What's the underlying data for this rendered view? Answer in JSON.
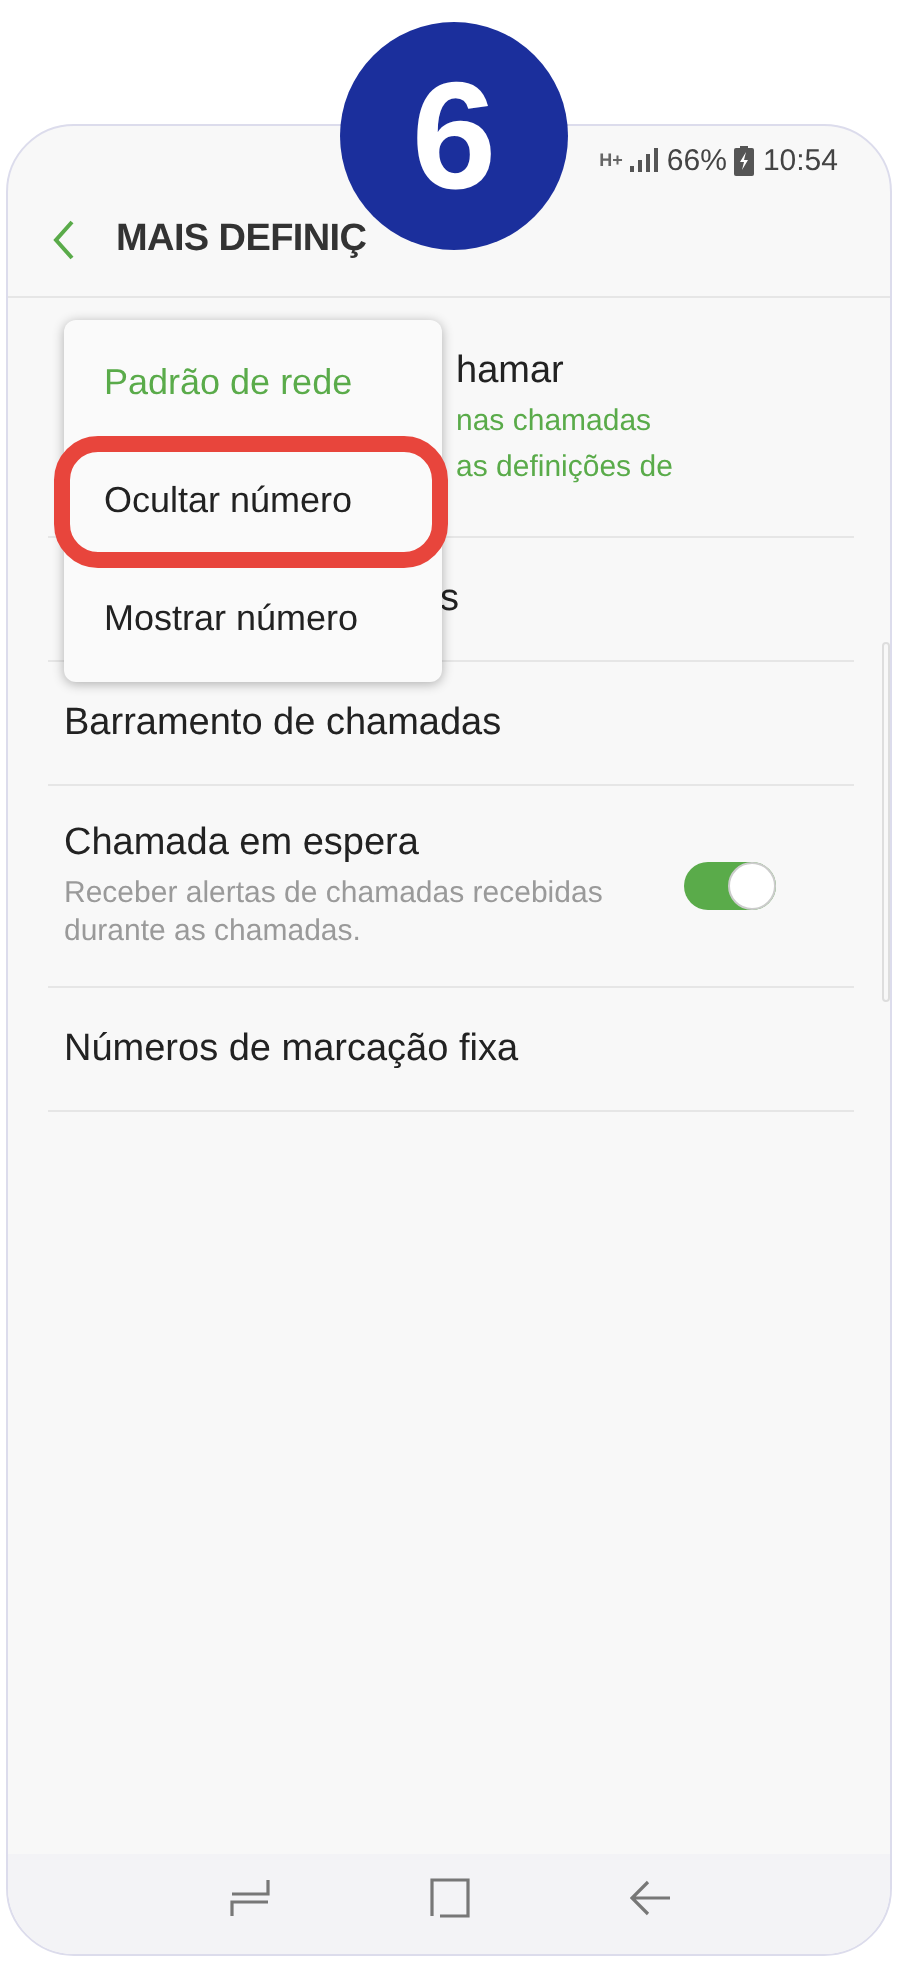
{
  "step_badge": {
    "number": "6"
  },
  "status_bar": {
    "network": "H+",
    "battery": "66%",
    "time": "10:54"
  },
  "header": {
    "title": "MAIS DEFINIÇ"
  },
  "rows": [
    {
      "kind": "covered",
      "title": "hamar",
      "subtitle_lines": [
        "nas chamadas",
        "as definições de"
      ],
      "accent": true
    },
    {
      "kind": "covered",
      "title": "s"
    },
    {
      "kind": "plain",
      "title": "Barramento de chamadas"
    },
    {
      "kind": "toggle",
      "title": "Chamada em espera",
      "subtitle": "Receber alertas de chamadas recebidas durante as chamadas.",
      "on": true
    },
    {
      "kind": "plain",
      "title": "Números de marcação fixa"
    }
  ],
  "popup_menu": {
    "items": [
      {
        "label": "Padrão de rede",
        "selected": true,
        "highlighted": false
      },
      {
        "label": "Ocultar número",
        "selected": false,
        "highlighted": true
      },
      {
        "label": "Mostrar número",
        "selected": false,
        "highlighted": false
      }
    ]
  }
}
